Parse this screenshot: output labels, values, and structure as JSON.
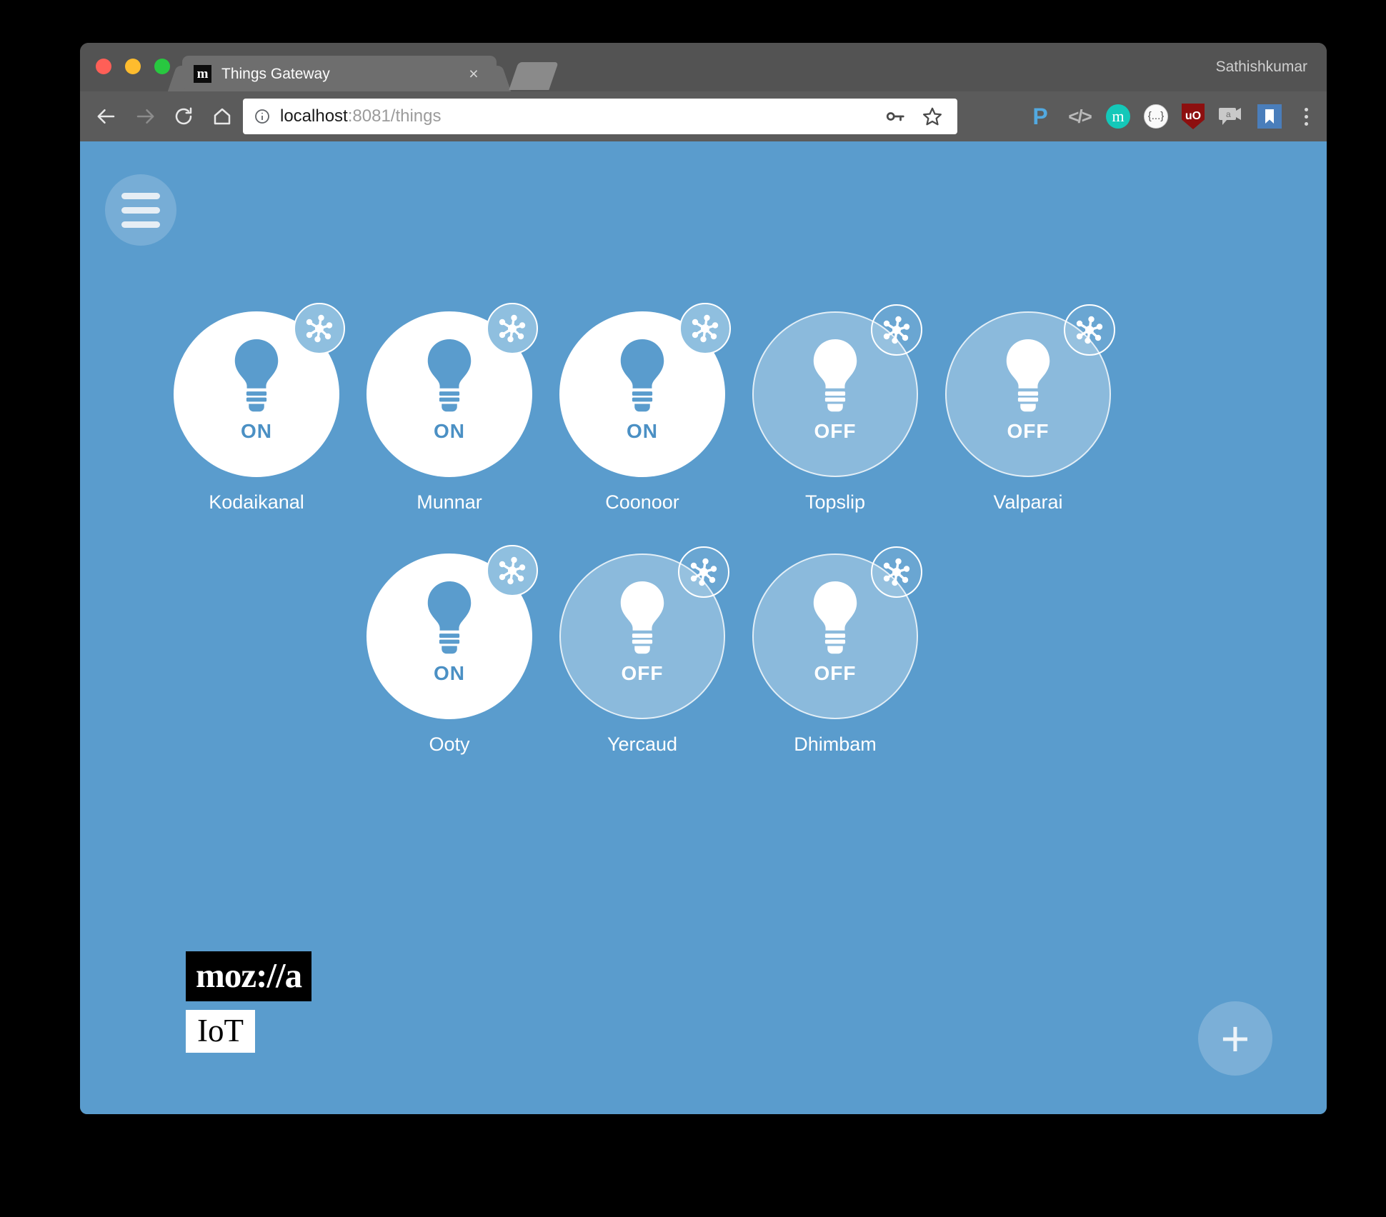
{
  "browser": {
    "traffic_lights": [
      "close",
      "minimize",
      "maximize"
    ],
    "tab": {
      "favicon_letter": "m",
      "title": "Things Gateway",
      "close_label": "×"
    },
    "new_tab_icon": "new-tab-icon",
    "profile_name": "Sathishkumar",
    "nav": {
      "back_icon": "back-arrow-icon",
      "forward_icon": "forward-arrow-icon",
      "reload_icon": "reload-icon",
      "home_icon": "home-icon"
    },
    "omnibox": {
      "info_icon": "info-circle-icon",
      "url_host": "localhost",
      "url_path": ":8081/things",
      "url_full": "localhost:8081/things",
      "password_icon": "key-icon",
      "bookmark_icon": "star-outline-icon"
    },
    "extensions": [
      {
        "name": "pocket",
        "label": "P"
      },
      {
        "name": "code-viewer",
        "label": "</>"
      },
      {
        "name": "metamask",
        "label": "m"
      },
      {
        "name": "json-viewer",
        "label": "{...}"
      },
      {
        "name": "ublock-origin",
        "label": "uO"
      },
      {
        "name": "chat",
        "label": "a"
      },
      {
        "name": "bookmark-manager",
        "label": "⚑"
      },
      {
        "name": "chrome-menu",
        "label": "⋮"
      }
    ]
  },
  "page": {
    "menu_button_icon": "hamburger-menu-icon",
    "add_button_label": "+",
    "logo": {
      "wordmark": "moz://a",
      "product": "IoT"
    },
    "things": [
      [
        {
          "name": "Kodaikanal",
          "state": "ON",
          "state_class": "on"
        },
        {
          "name": "Munnar",
          "state": "ON",
          "state_class": "on"
        },
        {
          "name": "Coonoor",
          "state": "ON",
          "state_class": "on"
        },
        {
          "name": "Topslip",
          "state": "OFF",
          "state_class": "off"
        },
        {
          "name": "Valparai",
          "state": "OFF",
          "state_class": "off"
        }
      ],
      [
        {
          "name": "Ooty",
          "state": "ON",
          "state_class": "on"
        },
        {
          "name": "Yercaud",
          "state": "OFF",
          "state_class": "off"
        },
        {
          "name": "Dhimbam",
          "state": "OFF",
          "state_class": "off"
        }
      ]
    ]
  },
  "colors": {
    "page_background": "#5a9ccd",
    "chrome_toolbar": "#5b5b5b",
    "chrome_tabstrip": "#535353",
    "active_tab": "#6e6e6e",
    "on_bubble": "#ffffff",
    "on_accent": "#4b90c4",
    "off_text": "#ffffff"
  }
}
